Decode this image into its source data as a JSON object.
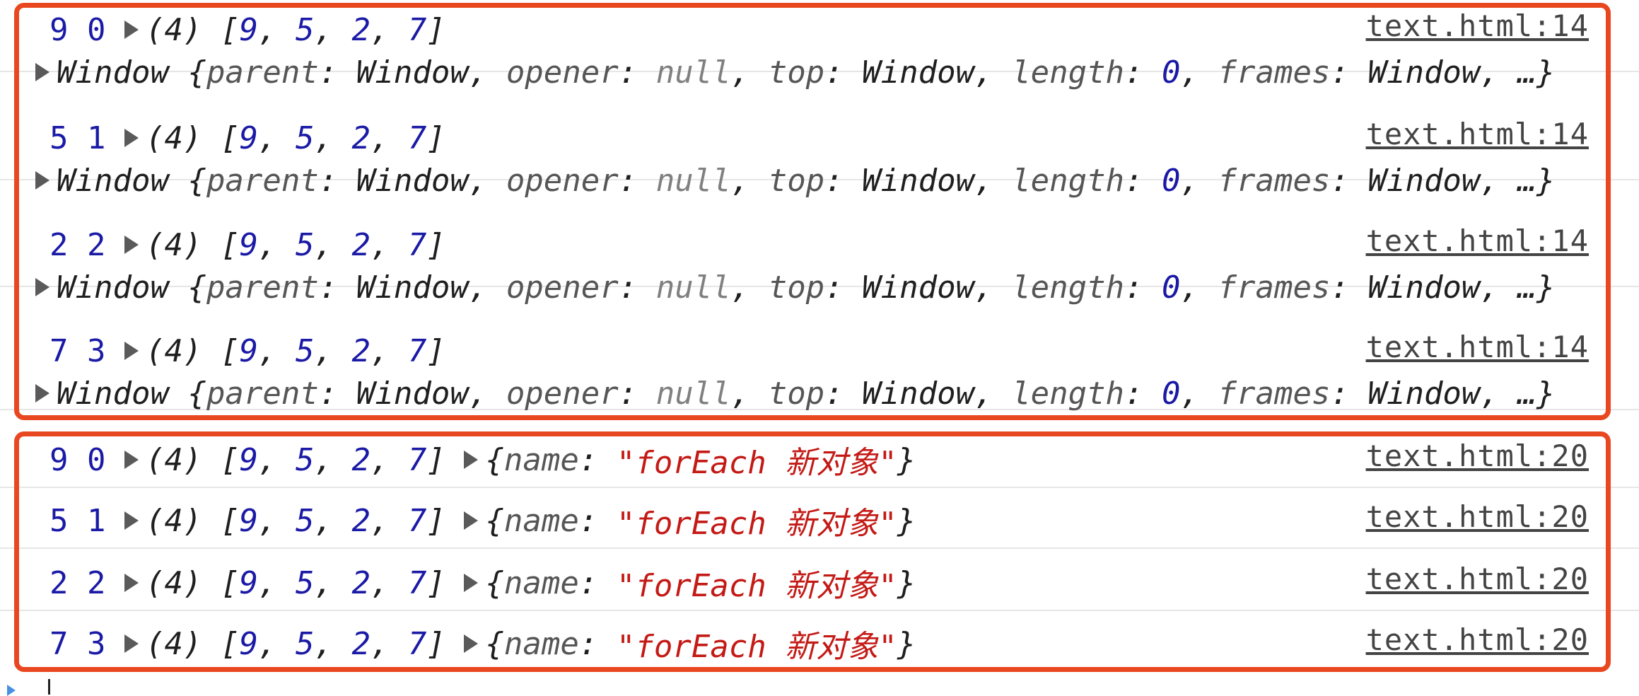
{
  "console": {
    "window_entries": [
      {
        "a": "9",
        "b": "0",
        "array_label": "(4)",
        "array": [
          "9",
          "5",
          "2",
          "7"
        ],
        "source": "text.html:14"
      },
      {
        "a": "5",
        "b": "1",
        "array_label": "(4)",
        "array": [
          "9",
          "5",
          "2",
          "7"
        ],
        "source": "text.html:14"
      },
      {
        "a": "2",
        "b": "2",
        "array_label": "(4)",
        "array": [
          "9",
          "5",
          "2",
          "7"
        ],
        "source": "text.html:14"
      },
      {
        "a": "7",
        "b": "3",
        "array_label": "(4)",
        "array": [
          "9",
          "5",
          "2",
          "7"
        ],
        "source": "text.html:14"
      }
    ],
    "window_line": {
      "name": "Window",
      "k_parent": "parent",
      "v_parent": "Window",
      "k_opener": "opener",
      "v_opener": "null",
      "k_top": "top",
      "v_top": "Window",
      "k_length": "length",
      "v_length": "0",
      "k_frames": "frames",
      "v_frames": "Window",
      "ellipsis": "…"
    },
    "object_entries": [
      {
        "a": "9",
        "b": "0",
        "array_label": "(4)",
        "array": [
          "9",
          "5",
          "2",
          "7"
        ],
        "obj_key": "name",
        "obj_value": "\"forEach 新对象\"",
        "source": "text.html:20"
      },
      {
        "a": "5",
        "b": "1",
        "array_label": "(4)",
        "array": [
          "9",
          "5",
          "2",
          "7"
        ],
        "obj_key": "name",
        "obj_value": "\"forEach 新对象\"",
        "source": "text.html:20"
      },
      {
        "a": "2",
        "b": "2",
        "array_label": "(4)",
        "array": [
          "9",
          "5",
          "2",
          "7"
        ],
        "obj_key": "name",
        "obj_value": "\"forEach 新对象\"",
        "source": "text.html:20"
      },
      {
        "a": "7",
        "b": "3",
        "array_label": "(4)",
        "array": [
          "9",
          "5",
          "2",
          "7"
        ],
        "obj_key": "name",
        "obj_value": "\"forEach 新对象\"",
        "source": "text.html:20"
      }
    ]
  },
  "colors": {
    "highlight_box": "#e8471f",
    "number": "#1a1aa6",
    "string": "#c41a16",
    "null": "#808080"
  }
}
